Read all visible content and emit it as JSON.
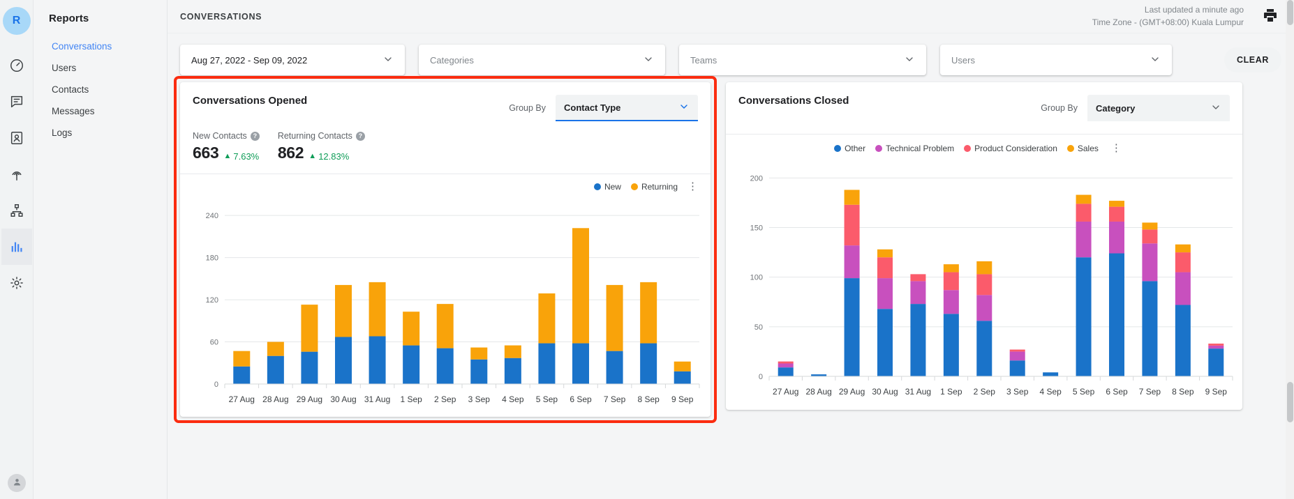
{
  "rail": {
    "avatar_initial": "R",
    "items": [
      {
        "name": "dashboard-icon",
        "label": "Dashboard"
      },
      {
        "name": "chat-icon",
        "label": "Chats"
      },
      {
        "name": "contacts-icon",
        "label": "Contacts"
      },
      {
        "name": "broadcast-icon",
        "label": "Broadcasts"
      },
      {
        "name": "workflow-icon",
        "label": "Workflows"
      },
      {
        "name": "reports-icon",
        "label": "Reports",
        "active": true
      },
      {
        "name": "settings-icon",
        "label": "Settings"
      }
    ]
  },
  "nav": {
    "title": "Reports",
    "items": [
      {
        "label": "Conversations",
        "active": true
      },
      {
        "label": "Users",
        "active": false
      },
      {
        "label": "Contacts",
        "active": false
      },
      {
        "label": "Messages",
        "active": false
      },
      {
        "label": "Logs",
        "active": false
      }
    ]
  },
  "topbar": {
    "breadcrumb": "CONVERSATIONS",
    "last_updated": "Last updated a minute ago",
    "timezone": "Time Zone - (GMT+08:00) Kuala Lumpur",
    "print_icon": "printer-icon"
  },
  "filters": {
    "date_range": "Aug 27, 2022 - Sep 09, 2022",
    "categories_placeholder": "Categories",
    "teams_placeholder": "Teams",
    "users_placeholder": "Users",
    "clear_label": "CLEAR"
  },
  "cards": {
    "opened": {
      "title": "Conversations Opened",
      "group_by_label": "Group By",
      "group_by_value": "Contact Type",
      "metrics": [
        {
          "label": "New Contacts",
          "value": "663",
          "delta": "7.63%",
          "direction": "up"
        },
        {
          "label": "Returning Contacts",
          "value": "862",
          "delta": "12.83%",
          "direction": "up"
        }
      ],
      "highlighted": true
    },
    "closed": {
      "title": "Conversations Closed",
      "group_by_label": "Group By",
      "group_by_value": "Category",
      "highlighted": false
    }
  },
  "chart_data": [
    {
      "type": "bar",
      "stacked": true,
      "title": "Conversations Opened",
      "xlabel": "",
      "ylabel": "",
      "ylim": [
        0,
        260
      ],
      "yticks": [
        0,
        60,
        120,
        180,
        240
      ],
      "grid": true,
      "legend_position": "top-right",
      "categories": [
        "27 Aug",
        "28 Aug",
        "29 Aug",
        "30 Aug",
        "31 Aug",
        "1 Sep",
        "2 Sep",
        "3 Sep",
        "4 Sep",
        "5 Sep",
        "6 Sep",
        "7 Sep",
        "8 Sep",
        "9 Sep"
      ],
      "series": [
        {
          "name": "New",
          "color": "#1a73c9",
          "values": [
            25,
            40,
            46,
            67,
            68,
            55,
            51,
            35,
            37,
            58,
            58,
            47,
            58,
            18
          ]
        },
        {
          "name": "Returning",
          "color": "#f9a30a",
          "values": [
            22,
            20,
            67,
            74,
            77,
            48,
            63,
            17,
            18,
            71,
            164,
            94,
            87,
            14
          ]
        }
      ],
      "totals": [
        47,
        60,
        113,
        141,
        145,
        103,
        114,
        52,
        55,
        129,
        222,
        141,
        145,
        32
      ]
    },
    {
      "type": "bar",
      "stacked": true,
      "title": "Conversations Closed",
      "xlabel": "",
      "ylabel": "",
      "ylim": [
        0,
        215
      ],
      "yticks": [
        0,
        50,
        100,
        150,
        200
      ],
      "grid": true,
      "legend_position": "top-right",
      "categories": [
        "27 Aug",
        "28 Aug",
        "29 Aug",
        "30 Aug",
        "31 Aug",
        "1 Sep",
        "2 Sep",
        "3 Sep",
        "4 Sep",
        "5 Sep",
        "6 Sep",
        "7 Sep",
        "8 Sep",
        "9 Sep"
      ],
      "series": [
        {
          "name": "Other",
          "color": "#1a73c9",
          "values": [
            9,
            2,
            99,
            68,
            73,
            63,
            56,
            16,
            4,
            120,
            124,
            96,
            72,
            28
          ]
        },
        {
          "name": "Technical Problem",
          "color": "#c martin",
          "values": [
            0,
            0,
            0,
            0,
            0,
            0,
            0,
            0,
            0,
            0,
            0,
            0,
            0,
            0
          ]
        },
        {
          "name": "Product Consideration",
          "color": "#fb5b6b",
          "values": [
            0,
            0,
            0,
            0,
            0,
            0,
            0,
            0,
            0,
            0,
            0,
            0,
            0,
            0
          ]
        },
        {
          "name": "Sales",
          "color": "#f9a30a",
          "values": [
            0,
            0,
            0,
            0,
            0,
            0,
            0,
            0,
            0,
            0,
            0,
            0,
            0,
            0
          ]
        }
      ],
      "series_fixed": [
        {
          "name": "Other",
          "color": "#1a73c9",
          "values": [
            9,
            2,
            99,
            68,
            73,
            63,
            56,
            16,
            4,
            120,
            124,
            96,
            72,
            28
          ]
        },
        {
          "name": "Technical Problem",
          "color": "#c850be",
          "values": [
            4,
            0,
            33,
            31,
            23,
            24,
            26,
            9,
            0,
            36,
            32,
            38,
            33,
            3
          ]
        },
        {
          "name": "Product Consideration",
          "color": "#fb5b6b",
          "values": [
            2,
            0,
            41,
            21,
            7,
            18,
            21,
            2,
            0,
            18,
            15,
            14,
            20,
            2
          ]
        },
        {
          "name": "Sales",
          "color": "#f9a30a",
          "values": [
            0,
            0,
            15,
            8,
            0,
            8,
            13,
            0,
            0,
            9,
            6,
            7,
            8,
            0
          ]
        }
      ],
      "legend": [
        {
          "label": "Other",
          "color": "#1a73c9"
        },
        {
          "label": "Technical Problem",
          "color": "#c850be"
        },
        {
          "label": "Product Consideration",
          "color": "#fb5b6b"
        },
        {
          "label": "Sales",
          "color": "#f9a30a"
        }
      ],
      "totals": [
        15,
        2,
        188,
        128,
        103,
        113,
        116,
        27,
        4,
        183,
        177,
        155,
        133,
        33
      ]
    }
  ],
  "legends": {
    "opened": [
      {
        "label": "New",
        "color": "#1a73c9"
      },
      {
        "label": "Returning",
        "color": "#f9a30a"
      }
    ],
    "closed": [
      {
        "label": "Other",
        "color": "#1a73c9"
      },
      {
        "label": "Technical Problem",
        "color": "#c850be"
      },
      {
        "label": "Product Consideration",
        "color": "#fb5b6b"
      },
      {
        "label": "Sales",
        "color": "#f9a30a"
      }
    ]
  }
}
